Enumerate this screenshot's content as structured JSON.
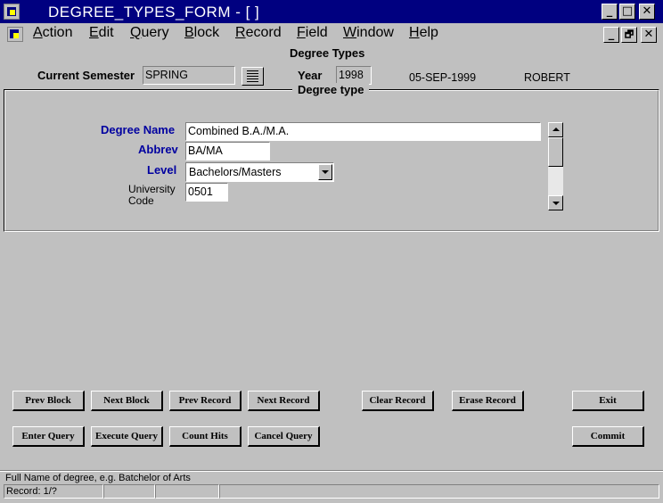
{
  "window": {
    "title": "DEGREE_TYPES_FORM - [ ]",
    "controls": {
      "minimize": "_",
      "maximize": "□",
      "close": "✕",
      "restore": "🗗"
    }
  },
  "menu": [
    {
      "label_u": "A",
      "label_rest": "ction"
    },
    {
      "label_u": "E",
      "label_rest": "dit"
    },
    {
      "label_u": "Q",
      "label_rest": "uery"
    },
    {
      "label_u": "B",
      "label_rest": "lock"
    },
    {
      "label_u": "R",
      "label_rest": "ecord"
    },
    {
      "label_u": "F",
      "label_rest": "ield"
    },
    {
      "label_u": "W",
      "label_rest": "indow"
    },
    {
      "label_u": "H",
      "label_rest": "elp"
    }
  ],
  "header": {
    "form_title": "Degree Types",
    "current_semester_label": "Current Semester",
    "current_semester_value": "SPRING",
    "year_label": "Year",
    "year_value": "1998",
    "date": "05-SEP-1999",
    "user": "ROBERT"
  },
  "block": {
    "title": "Degree type",
    "degree_name_label": "Degree Name",
    "degree_name_value": "Combined B.A./M.A.",
    "abbrev_label": "Abbrev",
    "abbrev_value": "BA/MA",
    "level_label": "Level",
    "level_value": "Bachelors/Masters",
    "university_code_label_1": "University",
    "university_code_label_2": "Code",
    "university_code_value": "0501"
  },
  "buttons": {
    "prev_block": "Prev Block",
    "next_block": "Next Block",
    "prev_record": "Prev Record",
    "next_record": "Next Record",
    "clear_record": "Clear Record",
    "erase_record": "Erase Record",
    "exit": "Exit",
    "enter_query": "Enter Query",
    "execute_query": "Execute Query",
    "count_hits": "Count Hits",
    "cancel_query": "Cancel Query",
    "commit": "Commit"
  },
  "status": {
    "message": "Full Name of degree, e.g. Batchelor of Arts",
    "record": "Record: 1/?"
  },
  "colors": {
    "title_bar": "#000080",
    "label_blue": "#0000a0",
    "face": "#c0c0c0"
  }
}
